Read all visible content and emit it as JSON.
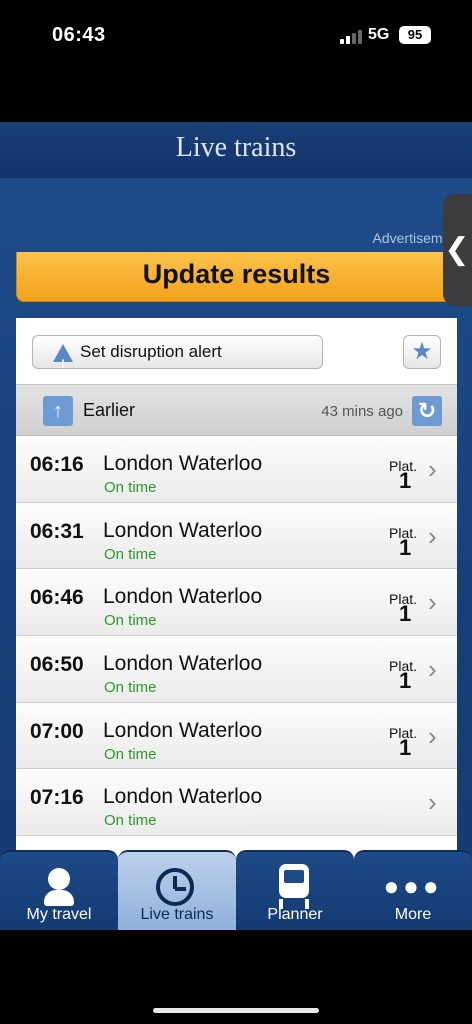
{
  "status_bar": {
    "time": "06:43",
    "network": "5G",
    "battery": "95"
  },
  "header": {
    "title": "Live trains"
  },
  "ad_label": "Advertisement",
  "side_tab": {
    "icon": "chevron-left-icon",
    "glyph": "❮"
  },
  "update_button": {
    "label": "Update results"
  },
  "disruption_alert": {
    "label": "Set disruption alert",
    "icon": "warning-icon"
  },
  "favourite": {
    "icon": "star-icon",
    "glyph": "★"
  },
  "earlier": {
    "label": "Earlier",
    "updated": "43 mins ago",
    "up_glyph": "↑",
    "refresh_glyph": "↻"
  },
  "plat_label": "Plat.",
  "trains": [
    {
      "time": "06:16",
      "destination": "London Waterloo",
      "status": "On time",
      "platform": "1"
    },
    {
      "time": "06:31",
      "destination": "London Waterloo",
      "status": "On time",
      "platform": "1"
    },
    {
      "time": "06:46",
      "destination": "London Waterloo",
      "status": "On time",
      "platform": "1"
    },
    {
      "time": "06:50",
      "destination": "London Waterloo",
      "status": "On time",
      "platform": "1"
    },
    {
      "time": "07:00",
      "destination": "London Waterloo",
      "status": "On time",
      "platform": "1"
    },
    {
      "time": "07:16",
      "destination": "London Waterloo",
      "status": "On time",
      "platform": ""
    }
  ],
  "nav": [
    {
      "label": "My travel",
      "icon": "person-icon"
    },
    {
      "label": "Live trains",
      "icon": "clock-icon",
      "active": true
    },
    {
      "label": "Planner",
      "icon": "train-icon"
    },
    {
      "label": "More",
      "icon": "more-dots-icon"
    }
  ],
  "colors": {
    "accent": "#f2a21a",
    "on_time": "#2c9a2c",
    "brand_blue": "#1d4a88"
  }
}
